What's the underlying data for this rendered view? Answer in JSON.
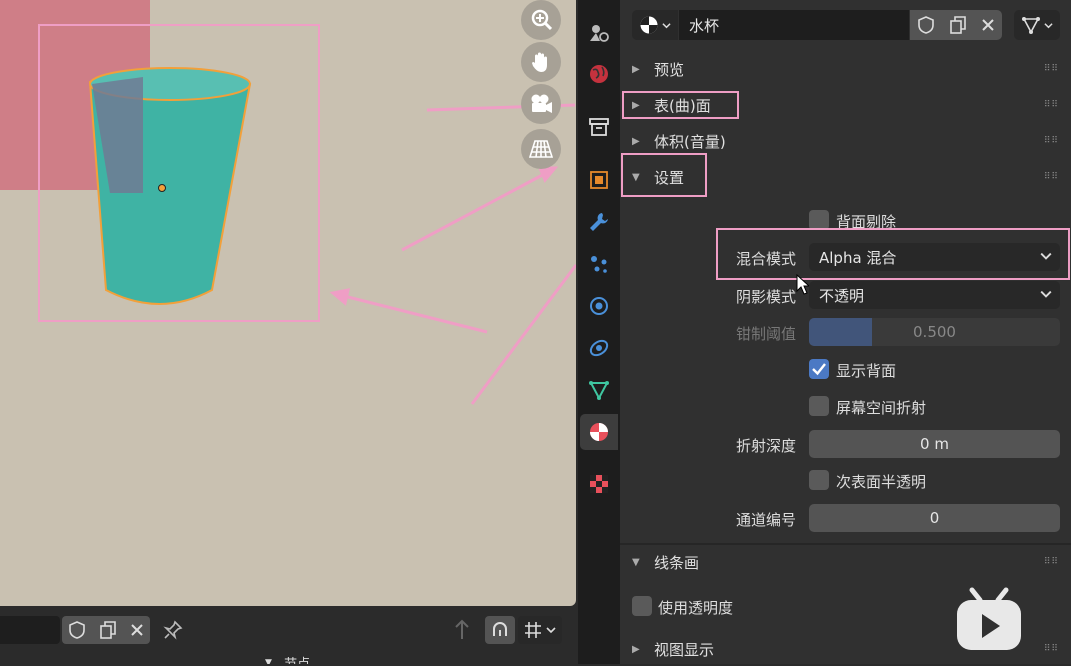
{
  "material": {
    "name": "水杯"
  },
  "panels": {
    "preview": "预览",
    "surface": "表(曲)面",
    "volume": "体积(音量)",
    "settings": "设置",
    "lineart": "线条画",
    "viewport_display": "视图显示",
    "nodes": "节点"
  },
  "settings": {
    "backface_culling": {
      "label": "背面剔除",
      "checked": false
    },
    "blend_mode": {
      "label": "混合模式",
      "value": "Alpha 混合"
    },
    "shadow_mode": {
      "label": "阴影模式",
      "value": "不透明"
    },
    "clip_threshold": {
      "label": "钳制阈值",
      "value": "0.500",
      "fraction": 0.25
    },
    "show_backface": {
      "label": "显示背面",
      "checked": true
    },
    "screen_space_refraction": {
      "label": "屏幕空间折射",
      "checked": false
    },
    "refraction_depth": {
      "label": "折射深度",
      "value": "0 m"
    },
    "subsurface_translucency": {
      "label": "次表面半透明",
      "checked": false
    },
    "pass_index": {
      "label": "通道编号",
      "value": "0"
    }
  },
  "lineart": {
    "use_transparency": {
      "label": "使用透明度",
      "checked": false
    }
  },
  "colors": {
    "accent_pink": "#ef9ec5",
    "cup_teal": "#3fb3a4",
    "checkbox_blue": "#4b79c4"
  },
  "icons": [
    "zoom-icon",
    "hand-icon",
    "camera-icon",
    "grid-icon",
    "material-icon",
    "shield-icon",
    "duplicate-icon",
    "close-icon",
    "node-tree-icon",
    "pin-icon",
    "bilibili-icon"
  ]
}
